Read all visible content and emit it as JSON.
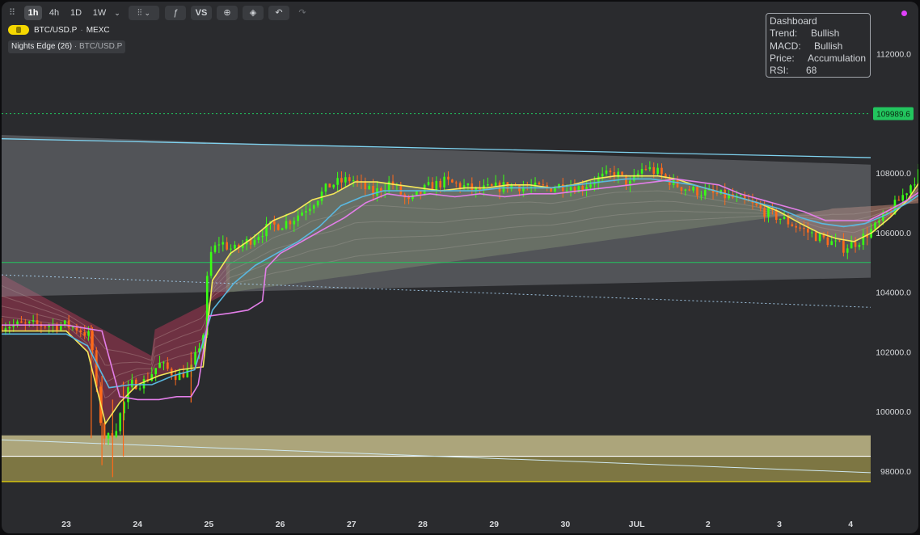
{
  "toolbar": {
    "intervals": [
      "1h",
      "4h",
      "1D",
      "1W"
    ],
    "vs_label": "VS"
  },
  "symbol": {
    "name": "BTC/USD.P",
    "exchange": "MEXC"
  },
  "indicator": {
    "name": "Nights Edge (26)",
    "symbol": "BTC/USD.P"
  },
  "dashboard": {
    "title": "Dashboard",
    "rows": [
      {
        "key": "Trend:",
        "value": "Bullish"
      },
      {
        "key": "MACD:",
        "value": "Bullish"
      },
      {
        "key": "Price:",
        "value": "Accumulation"
      },
      {
        "key": "RSI:",
        "value": "68"
      }
    ]
  },
  "colors": {
    "background": "#2a2b2e",
    "bull_candle": "#39ff14",
    "bear_candle": "#ff6a1a",
    "last_price_badge": "#22c55e",
    "fast_ma": "#f5e85a",
    "mid_ma": "#5ab8e0",
    "slow_ma": "#e27ee8",
    "support_zone": "#c9c08a"
  },
  "chart_data": {
    "type": "candlestick",
    "x_tick_labels": [
      "23",
      "24",
      "25",
      "26",
      "27",
      "28",
      "29",
      "30",
      "JUL",
      "2",
      "3",
      "4"
    ],
    "y_tick_labels": [
      "112000.0",
      "108000.0",
      "106000.0",
      "104000.0",
      "102000.0",
      "100000.0",
      "98000.0"
    ],
    "ylim": [
      97200,
      113400
    ],
    "last_price": "109989.6",
    "price_path": [
      [
        23.0,
        102900
      ],
      [
        23.15,
        102800
      ],
      [
        23.35,
        102500
      ],
      [
        23.45,
        100000
      ],
      [
        23.55,
        99000
      ],
      [
        23.7,
        99500
      ],
      [
        23.9,
        100900
      ],
      [
        24.1,
        101000
      ],
      [
        24.3,
        101600
      ],
      [
        24.55,
        101200
      ],
      [
        24.75,
        101400
      ],
      [
        24.92,
        102600
      ],
      [
        25.0,
        105200
      ],
      [
        25.15,
        105700
      ],
      [
        25.35,
        105400
      ],
      [
        25.6,
        105800
      ],
      [
        25.85,
        106200
      ],
      [
        26.05,
        106300
      ],
      [
        26.2,
        106500
      ],
      [
        26.45,
        107000
      ],
      [
        26.7,
        107600
      ],
      [
        27.0,
        107800
      ],
      [
        27.3,
        107300
      ],
      [
        27.55,
        107700
      ],
      [
        27.8,
        107000
      ],
      [
        28.05,
        107500
      ],
      [
        28.3,
        107700
      ],
      [
        28.5,
        107600
      ],
      [
        28.75,
        107400
      ],
      [
        29.0,
        107500
      ],
      [
        29.25,
        107600
      ],
      [
        29.5,
        107500
      ],
      [
        29.75,
        107500
      ],
      [
        30.0,
        107600
      ],
      [
        30.2,
        107500
      ],
      [
        30.45,
        107800
      ],
      [
        30.7,
        108000
      ],
      [
        30.9,
        107600
      ],
      [
        31.1,
        108200
      ],
      [
        31.3,
        108000
      ],
      [
        31.55,
        107600
      ],
      [
        31.8,
        107400
      ],
      [
        32.05,
        107300
      ],
      [
        32.3,
        107200
      ],
      [
        32.55,
        107000
      ],
      [
        32.8,
        106700
      ],
      [
        33.0,
        106500
      ],
      [
        33.25,
        106200
      ],
      [
        33.5,
        105900
      ],
      [
        33.7,
        105700
      ],
      [
        33.9,
        105500
      ],
      [
        34.1,
        105700
      ],
      [
        34.35,
        106200
      ],
      [
        34.55,
        106700
      ],
      [
        34.75,
        107300
      ],
      [
        34.9,
        107800
      ],
      [
        35.05,
        108300
      ],
      [
        35.2,
        109300
      ],
      [
        35.35,
        109300
      ],
      [
        35.5,
        109000
      ],
      [
        35.65,
        109000
      ],
      [
        35.75,
        109100
      ],
      [
        35.85,
        109300
      ],
      [
        35.95,
        109300
      ],
      [
        36.05,
        109500
      ],
      [
        36.25,
        109500
      ],
      [
        36.4,
        109950
      ]
    ],
    "moving_averages": [
      {
        "name": "fast",
        "color": "#f5e85a",
        "values": [
          [
            23.0,
            102700
          ],
          [
            23.3,
            102000
          ],
          [
            23.55,
            99600
          ],
          [
            23.75,
            100300
          ],
          [
            24.0,
            100900
          ],
          [
            24.3,
            101200
          ],
          [
            24.6,
            101400
          ],
          [
            24.92,
            101500
          ],
          [
            25.05,
            104400
          ],
          [
            25.3,
            105300
          ],
          [
            25.6,
            105800
          ],
          [
            25.9,
            106400
          ],
          [
            26.2,
            106700
          ],
          [
            26.45,
            107100
          ],
          [
            26.75,
            107300
          ],
          [
            27.05,
            107700
          ],
          [
            27.35,
            107700
          ],
          [
            27.65,
            107600
          ],
          [
            27.95,
            107500
          ],
          [
            28.25,
            107400
          ],
          [
            28.6,
            107500
          ],
          [
            28.9,
            107500
          ],
          [
            29.2,
            107600
          ],
          [
            29.5,
            107600
          ],
          [
            29.8,
            107500
          ],
          [
            30.1,
            107600
          ],
          [
            30.4,
            107800
          ],
          [
            30.7,
            107900
          ],
          [
            31.0,
            107900
          ],
          [
            31.3,
            107900
          ],
          [
            31.55,
            107800
          ],
          [
            31.8,
            107600
          ],
          [
            32.1,
            107400
          ],
          [
            32.4,
            107200
          ],
          [
            32.7,
            107000
          ],
          [
            33.0,
            106700
          ],
          [
            33.3,
            106300
          ],
          [
            33.55,
            106000
          ],
          [
            33.8,
            105800
          ],
          [
            34.05,
            105700
          ],
          [
            34.3,
            106000
          ],
          [
            34.55,
            106500
          ],
          [
            34.8,
            107100
          ],
          [
            35.05,
            108000
          ],
          [
            35.3,
            108900
          ],
          [
            35.55,
            109000
          ],
          [
            35.8,
            109100
          ],
          [
            36.0,
            109200
          ],
          [
            36.2,
            109300
          ],
          [
            36.45,
            109600
          ]
        ]
      },
      {
        "name": "mid",
        "color": "#5ab8e0",
        "values": [
          [
            23.0,
            102600
          ],
          [
            23.3,
            102200
          ],
          [
            23.6,
            100800
          ],
          [
            23.9,
            100900
          ],
          [
            24.2,
            100900
          ],
          [
            24.5,
            101200
          ],
          [
            24.8,
            101400
          ],
          [
            25.05,
            103400
          ],
          [
            25.35,
            104300
          ],
          [
            25.65,
            104900
          ],
          [
            25.95,
            105300
          ],
          [
            26.25,
            105700
          ],
          [
            26.55,
            106200
          ],
          [
            26.85,
            106900
          ],
          [
            27.15,
            107200
          ],
          [
            27.45,
            107400
          ],
          [
            27.75,
            107400
          ],
          [
            28.05,
            107400
          ],
          [
            28.4,
            107400
          ],
          [
            28.75,
            107400
          ],
          [
            29.1,
            107500
          ],
          [
            29.45,
            107500
          ],
          [
            29.8,
            107500
          ],
          [
            30.15,
            107600
          ],
          [
            30.5,
            107700
          ],
          [
            30.85,
            107800
          ],
          [
            31.2,
            107800
          ],
          [
            31.5,
            107700
          ],
          [
            31.8,
            107600
          ],
          [
            32.1,
            107400
          ],
          [
            32.4,
            107200
          ],
          [
            32.7,
            107000
          ],
          [
            33.0,
            106800
          ],
          [
            33.3,
            106500
          ],
          [
            33.6,
            106300
          ],
          [
            33.9,
            106200
          ],
          [
            34.2,
            106300
          ],
          [
            34.5,
            106600
          ],
          [
            34.8,
            107000
          ],
          [
            35.1,
            107500
          ],
          [
            35.4,
            108100
          ],
          [
            35.7,
            108400
          ],
          [
            36.0,
            108600
          ],
          [
            36.2,
            108800
          ],
          [
            36.45,
            109100
          ]
        ]
      },
      {
        "name": "slow",
        "color": "#e27ee8",
        "values": [
          [
            23.0,
            102900
          ],
          [
            23.5,
            102700
          ],
          [
            23.75,
            100500
          ],
          [
            24.0,
            100400
          ],
          [
            24.3,
            100400
          ],
          [
            24.55,
            100500
          ],
          [
            24.75,
            100500
          ],
          [
            24.85,
            100900
          ],
          [
            25.0,
            103200
          ],
          [
            25.3,
            103300
          ],
          [
            25.55,
            103400
          ],
          [
            25.75,
            103700
          ],
          [
            25.8,
            104800
          ],
          [
            26.0,
            105300
          ],
          [
            26.3,
            105700
          ],
          [
            26.6,
            106100
          ],
          [
            26.9,
            106500
          ],
          [
            27.2,
            107000
          ],
          [
            27.5,
            107300
          ],
          [
            27.8,
            107200
          ],
          [
            28.1,
            107300
          ],
          [
            28.45,
            107200
          ],
          [
            28.8,
            107300
          ],
          [
            29.15,
            107200
          ],
          [
            29.5,
            107300
          ],
          [
            29.85,
            107300
          ],
          [
            30.2,
            107400
          ],
          [
            30.55,
            107500
          ],
          [
            30.9,
            107600
          ],
          [
            31.25,
            107700
          ],
          [
            31.55,
            107800
          ],
          [
            31.85,
            107700
          ],
          [
            32.15,
            107600
          ],
          [
            32.45,
            107300
          ],
          [
            32.75,
            107100
          ],
          [
            33.05,
            106900
          ],
          [
            33.35,
            106700
          ],
          [
            33.65,
            106400
          ],
          [
            33.95,
            106400
          ],
          [
            34.25,
            106400
          ],
          [
            34.5,
            106700
          ],
          [
            34.8,
            107100
          ],
          [
            35.05,
            107500
          ],
          [
            35.35,
            107700
          ],
          [
            35.65,
            107700
          ],
          [
            35.95,
            107800
          ],
          [
            36.2,
            108100
          ],
          [
            36.45,
            108800
          ]
        ]
      }
    ],
    "channel": {
      "upper_line": [
        [
          23.0,
          109100
        ],
        [
          36.45,
          108400
        ]
      ],
      "lower_line": [
        [
          23.0,
          104500
        ],
        [
          36.45,
          103300
        ]
      ],
      "top_edge": [
        [
          23.0,
          109200
        ],
        [
          36.45,
          108100
        ]
      ],
      "bottom_edge": [
        [
          23.0,
          103900
        ],
        [
          36.45,
          104600
        ]
      ]
    },
    "horizontal_levels": [
      {
        "value": 109989.6,
        "style": "dotted",
        "color": "#22c55e"
      },
      {
        "value": 105000,
        "style": "solid",
        "color": "#22c55e"
      }
    ],
    "support_zone": {
      "low": 97650,
      "high": 99200,
      "mid": 98500
    },
    "grid": false
  }
}
